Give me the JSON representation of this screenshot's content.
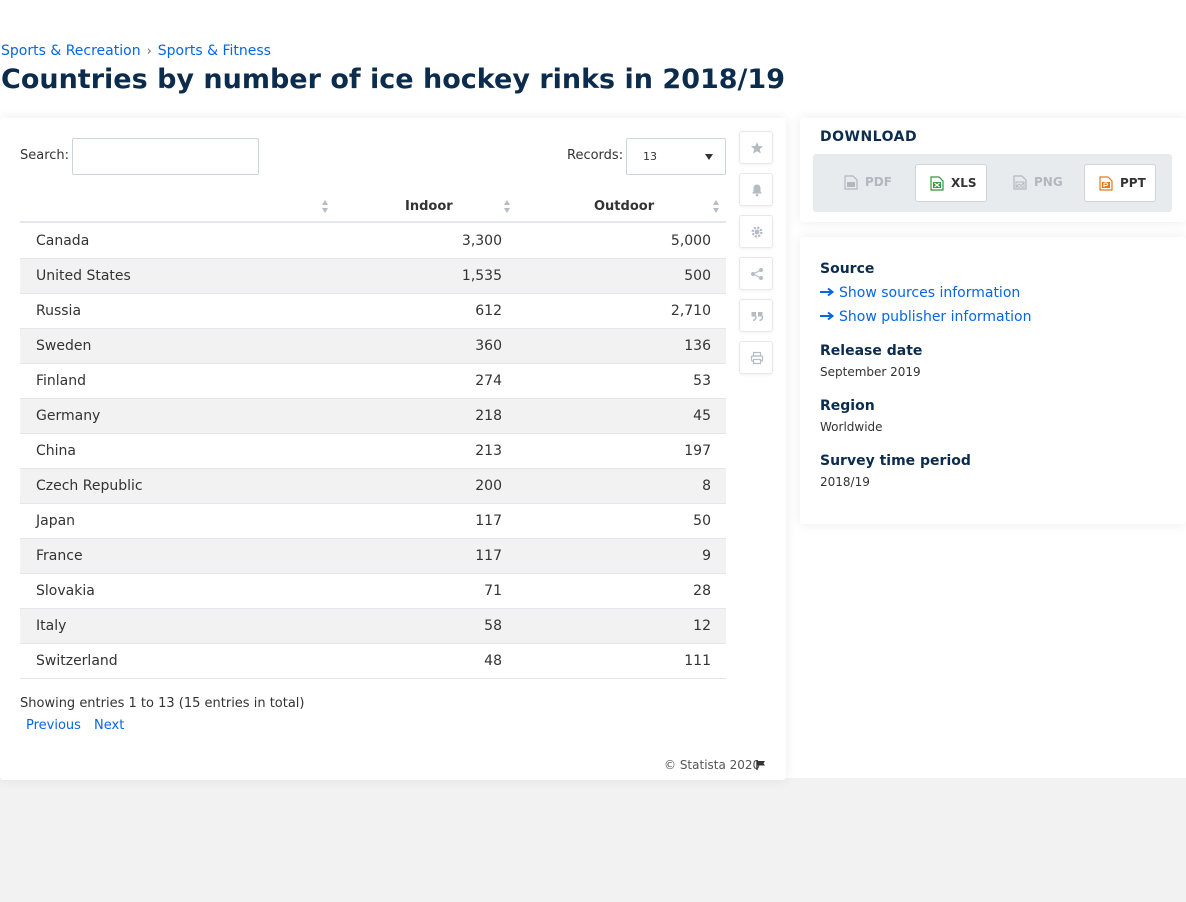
{
  "breadcrumb": {
    "items": [
      "Sports & Recreation",
      "Sports & Fitness"
    ],
    "separator": "›"
  },
  "page_title": "Countries by number of ice hockey rinks in 2018/19",
  "table_controls": {
    "search_label": "Search:",
    "search_value": "",
    "records_label": "Records:",
    "records_value": "13"
  },
  "table": {
    "headers": [
      "",
      "Indoor",
      "Outdoor"
    ],
    "rows": [
      [
        "Canada",
        "3,300",
        "5,000"
      ],
      [
        "United States",
        "1,535",
        "500"
      ],
      [
        "Russia",
        "612",
        "2,710"
      ],
      [
        "Sweden",
        "360",
        "136"
      ],
      [
        "Finland",
        "274",
        "53"
      ],
      [
        "Germany",
        "218",
        "45"
      ],
      [
        "China",
        "213",
        "197"
      ],
      [
        "Czech Republic",
        "200",
        "8"
      ],
      [
        "Japan",
        "117",
        "50"
      ],
      [
        "France",
        "117",
        "9"
      ],
      [
        "Slovakia",
        "71",
        "28"
      ],
      [
        "Italy",
        "58",
        "12"
      ],
      [
        "Switzerland",
        "48",
        "111"
      ]
    ],
    "showing_text": "Showing entries 1 to 13 (15 entries in total)",
    "prev_label": "Previous",
    "next_label": "Next"
  },
  "copyright": "© Statista 2020",
  "tools": [
    "star-icon",
    "bell-icon",
    "gear-icon",
    "share-icon",
    "quote-icon",
    "print-icon"
  ],
  "download": {
    "title": "DOWNLOAD",
    "buttons": [
      {
        "label": "PDF",
        "enabled": false
      },
      {
        "label": "XLS",
        "enabled": true
      },
      {
        "label": "PNG",
        "enabled": false
      },
      {
        "label": "PPT",
        "enabled": true
      }
    ]
  },
  "info": {
    "source_heading": "Source",
    "show_sources": "Show sources information",
    "show_publisher": "Show publisher information",
    "release_date_heading": "Release date",
    "release_date": "September 2019",
    "region_heading": "Region",
    "region": "Worldwide",
    "survey_heading": "Survey time period",
    "survey_period": "2018/19"
  },
  "colors": {
    "link": "#0666e5",
    "title": "#0b2c4d",
    "row_alt": "#f2f2f2",
    "xls_icon": "#2f9a3a",
    "ppt_icon": "#e8791b"
  }
}
